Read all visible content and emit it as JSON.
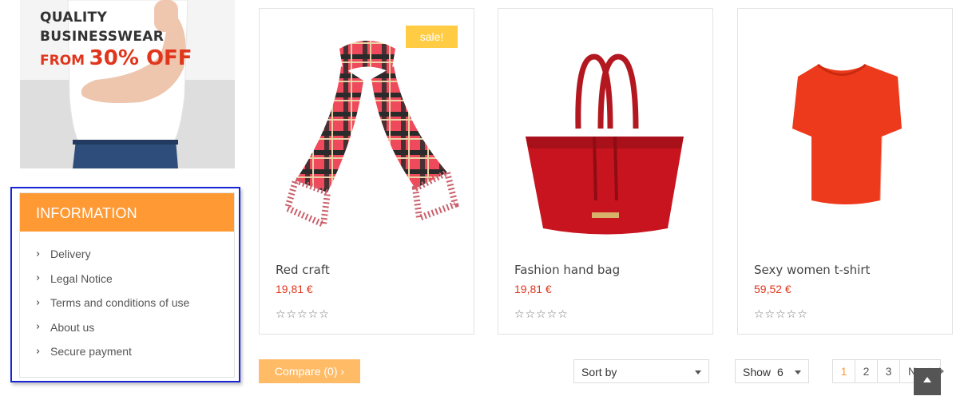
{
  "banner": {
    "line1": "QUALITY",
    "line2": "BUSINESSWEAR",
    "from": "FROM",
    "discount": "30% OFF"
  },
  "information": {
    "title": "INFORMATION",
    "items": [
      {
        "label": "Delivery"
      },
      {
        "label": "Legal Notice"
      },
      {
        "label": "Terms and conditions of use"
      },
      {
        "label": "About us"
      },
      {
        "label": "Secure payment"
      }
    ]
  },
  "products": [
    {
      "name": "Red craft",
      "price": "19,81 €",
      "badge": "sale!",
      "rating": 0,
      "image": "red-plaid-scarf"
    },
    {
      "name": "Fashion hand bag",
      "price": "19,81 €",
      "rating": 0,
      "image": "red-leather-handbag"
    },
    {
      "name": "Sexy women t-shirt",
      "price": "59,52 €",
      "rating": 0,
      "image": "red-t-shirt"
    }
  ],
  "toolbar": {
    "compare_label": "Compare (0) ›",
    "sort_label": "Sort by",
    "show_label": "Show",
    "show_value": "6"
  },
  "pagination": {
    "pages": [
      "1",
      "2",
      "3"
    ],
    "current": "1",
    "next_label": "Next"
  },
  "icons": {
    "chevron": "chevron-right-icon",
    "star": "star-outline-icon",
    "back_to_top": "arrow-up-icon"
  },
  "colors": {
    "accent": "#ff9933",
    "price": "#e0361d",
    "sale_badge": "#ffcc44",
    "compare_button": "#ffbb66"
  }
}
